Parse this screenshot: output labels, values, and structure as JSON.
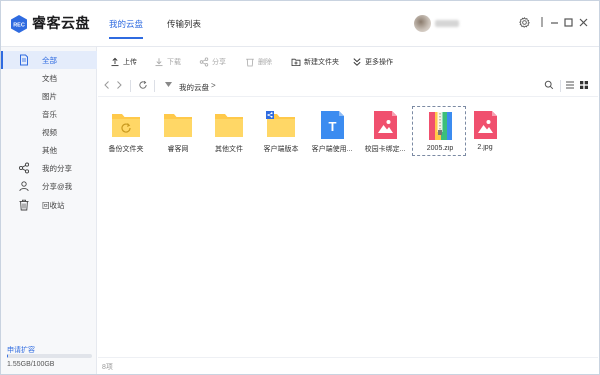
{
  "app": {
    "brand": "睿客云盘",
    "logo_text": "REC",
    "tabs": [
      {
        "label": "我的云盘",
        "active": true
      },
      {
        "label": "传输列表",
        "active": false
      }
    ]
  },
  "toolbar": {
    "upload": "上传",
    "download": "下载",
    "share": "分享",
    "delete": "删除",
    "new_folder": "新建文件夹",
    "more": "更多操作"
  },
  "sidebar": {
    "items": [
      {
        "label": "全部",
        "icon": "document-icon",
        "active": true
      },
      {
        "label": "文档",
        "icon": "",
        "active": false
      },
      {
        "label": "图片",
        "icon": "",
        "active": false
      },
      {
        "label": "音乐",
        "icon": "",
        "active": false
      },
      {
        "label": "视频",
        "icon": "",
        "active": false
      },
      {
        "label": "其他",
        "icon": "",
        "active": false
      },
      {
        "label": "我的分享",
        "icon": "share-icon",
        "active": false
      },
      {
        "label": "分享@我",
        "icon": "share-at-icon",
        "active": false
      },
      {
        "label": "回收站",
        "icon": "trash-icon",
        "active": false
      }
    ],
    "expand_label": "申请扩容",
    "quota_text": "1.55GB/100GB",
    "quota_fraction": 0.0155
  },
  "address": {
    "crumb": "我的云盘",
    "separator": ">"
  },
  "files": [
    {
      "name": "备份文件夹",
      "type": "folder-backup"
    },
    {
      "name": "睿客网",
      "type": "folder"
    },
    {
      "name": "其他文件",
      "type": "folder"
    },
    {
      "name": "客户端版本",
      "type": "folder-shared"
    },
    {
      "name": "客户端使用...",
      "type": "text-doc"
    },
    {
      "name": "校园卡绑定...",
      "type": "image"
    },
    {
      "name": "2005.zip",
      "type": "zip"
    },
    {
      "name": "2.jpg",
      "type": "image"
    }
  ],
  "status": {
    "count": "8项"
  },
  "colors": {
    "accent": "#2f6be0",
    "folder": "#ffc94a",
    "image_file": "#f0506e",
    "text_file": "#3c8cf0"
  }
}
